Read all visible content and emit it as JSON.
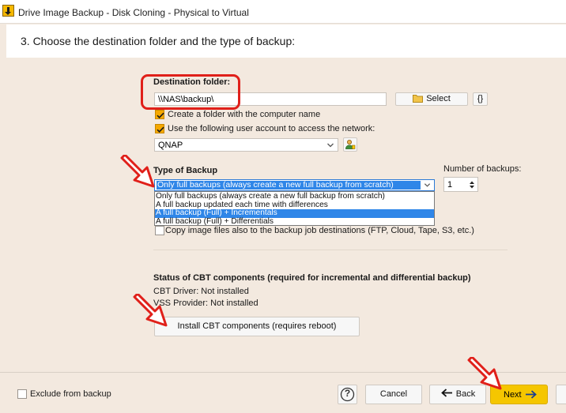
{
  "window": {
    "title": "Drive Image Backup - Disk Cloning - Physical to Virtual"
  },
  "header": {
    "heading": "3. Choose the destination folder and the type of backup:"
  },
  "destination": {
    "label": "Destination folder:",
    "path": "\\\\NAS\\backup\\",
    "select_label": "Select",
    "vars_label": "{}",
    "create_folder_label": "Create a folder with the computer name",
    "use_account_label": "Use the following user account to access the network:",
    "account": "QNAP"
  },
  "backup_type": {
    "label": "Type of Backup",
    "selected": "Only full backups (always create a new full backup from scratch)",
    "options": [
      "Only full backups (always create a new full backup from scratch)",
      "A full backup updated each time with differences",
      "A full backup (Full) + Incrementals",
      "A full backup (Full) + Differentials"
    ],
    "highlighted_index": 2,
    "copy_label": "Copy image files also to the backup job destinations (FTP, Cloud, Tape, S3, etc.)"
  },
  "number_of_backups": {
    "label": "Number of backups:",
    "value": "1"
  },
  "cbt": {
    "title": "Status of CBT components (required for incremental and differential backup)",
    "driver_status": "CBT Driver: Not installed",
    "vss_status": "VSS Provider: Not installed",
    "install_label": "Install CBT components (requires reboot)"
  },
  "footer": {
    "exclude_label": "Exclude from backup",
    "help_label": "?",
    "cancel_label": "Cancel",
    "back_label": "Back",
    "next_label": "Next"
  },
  "colors": {
    "accent": "#f5c600",
    "highlight": "#2f86e8",
    "annotation": "#e0201a"
  }
}
